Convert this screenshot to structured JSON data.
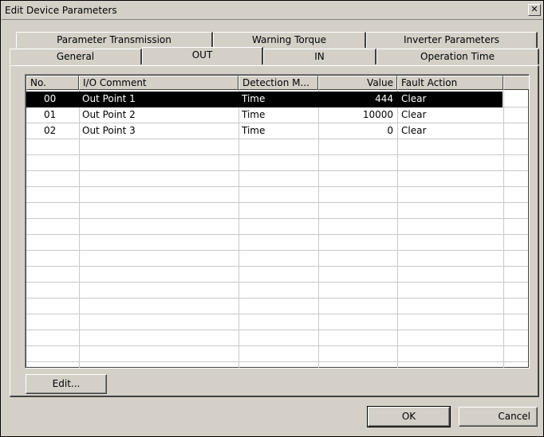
{
  "window": {
    "title": "Edit Device Parameters",
    "close_glyph": "✕"
  },
  "tabs": {
    "row1": [
      {
        "label": "Parameter Transmission"
      },
      {
        "label": "Warning Torque"
      },
      {
        "label": "Inverter Parameters"
      }
    ],
    "row2": [
      {
        "label": "General"
      },
      {
        "label": "OUT",
        "active": true
      },
      {
        "label": "IN"
      },
      {
        "label": "Operation Time"
      }
    ]
  },
  "table": {
    "columns": [
      "No.",
      "I/O Comment",
      "Detection M...",
      "Value",
      "Fault Action"
    ],
    "rows": [
      {
        "no": "00",
        "comment": "Out Point 1",
        "detection": "Time",
        "value": "444",
        "fault": "Clear",
        "selected": true
      },
      {
        "no": "01",
        "comment": "Out Point 2",
        "detection": "Time",
        "value": "10000",
        "fault": "Clear"
      },
      {
        "no": "02",
        "comment": "Out Point 3",
        "detection": "Time",
        "value": "0",
        "fault": "Clear"
      }
    ]
  },
  "buttons": {
    "edit_label": "Edit...",
    "ok_label": "OK",
    "cancel_label": "Cancel"
  }
}
